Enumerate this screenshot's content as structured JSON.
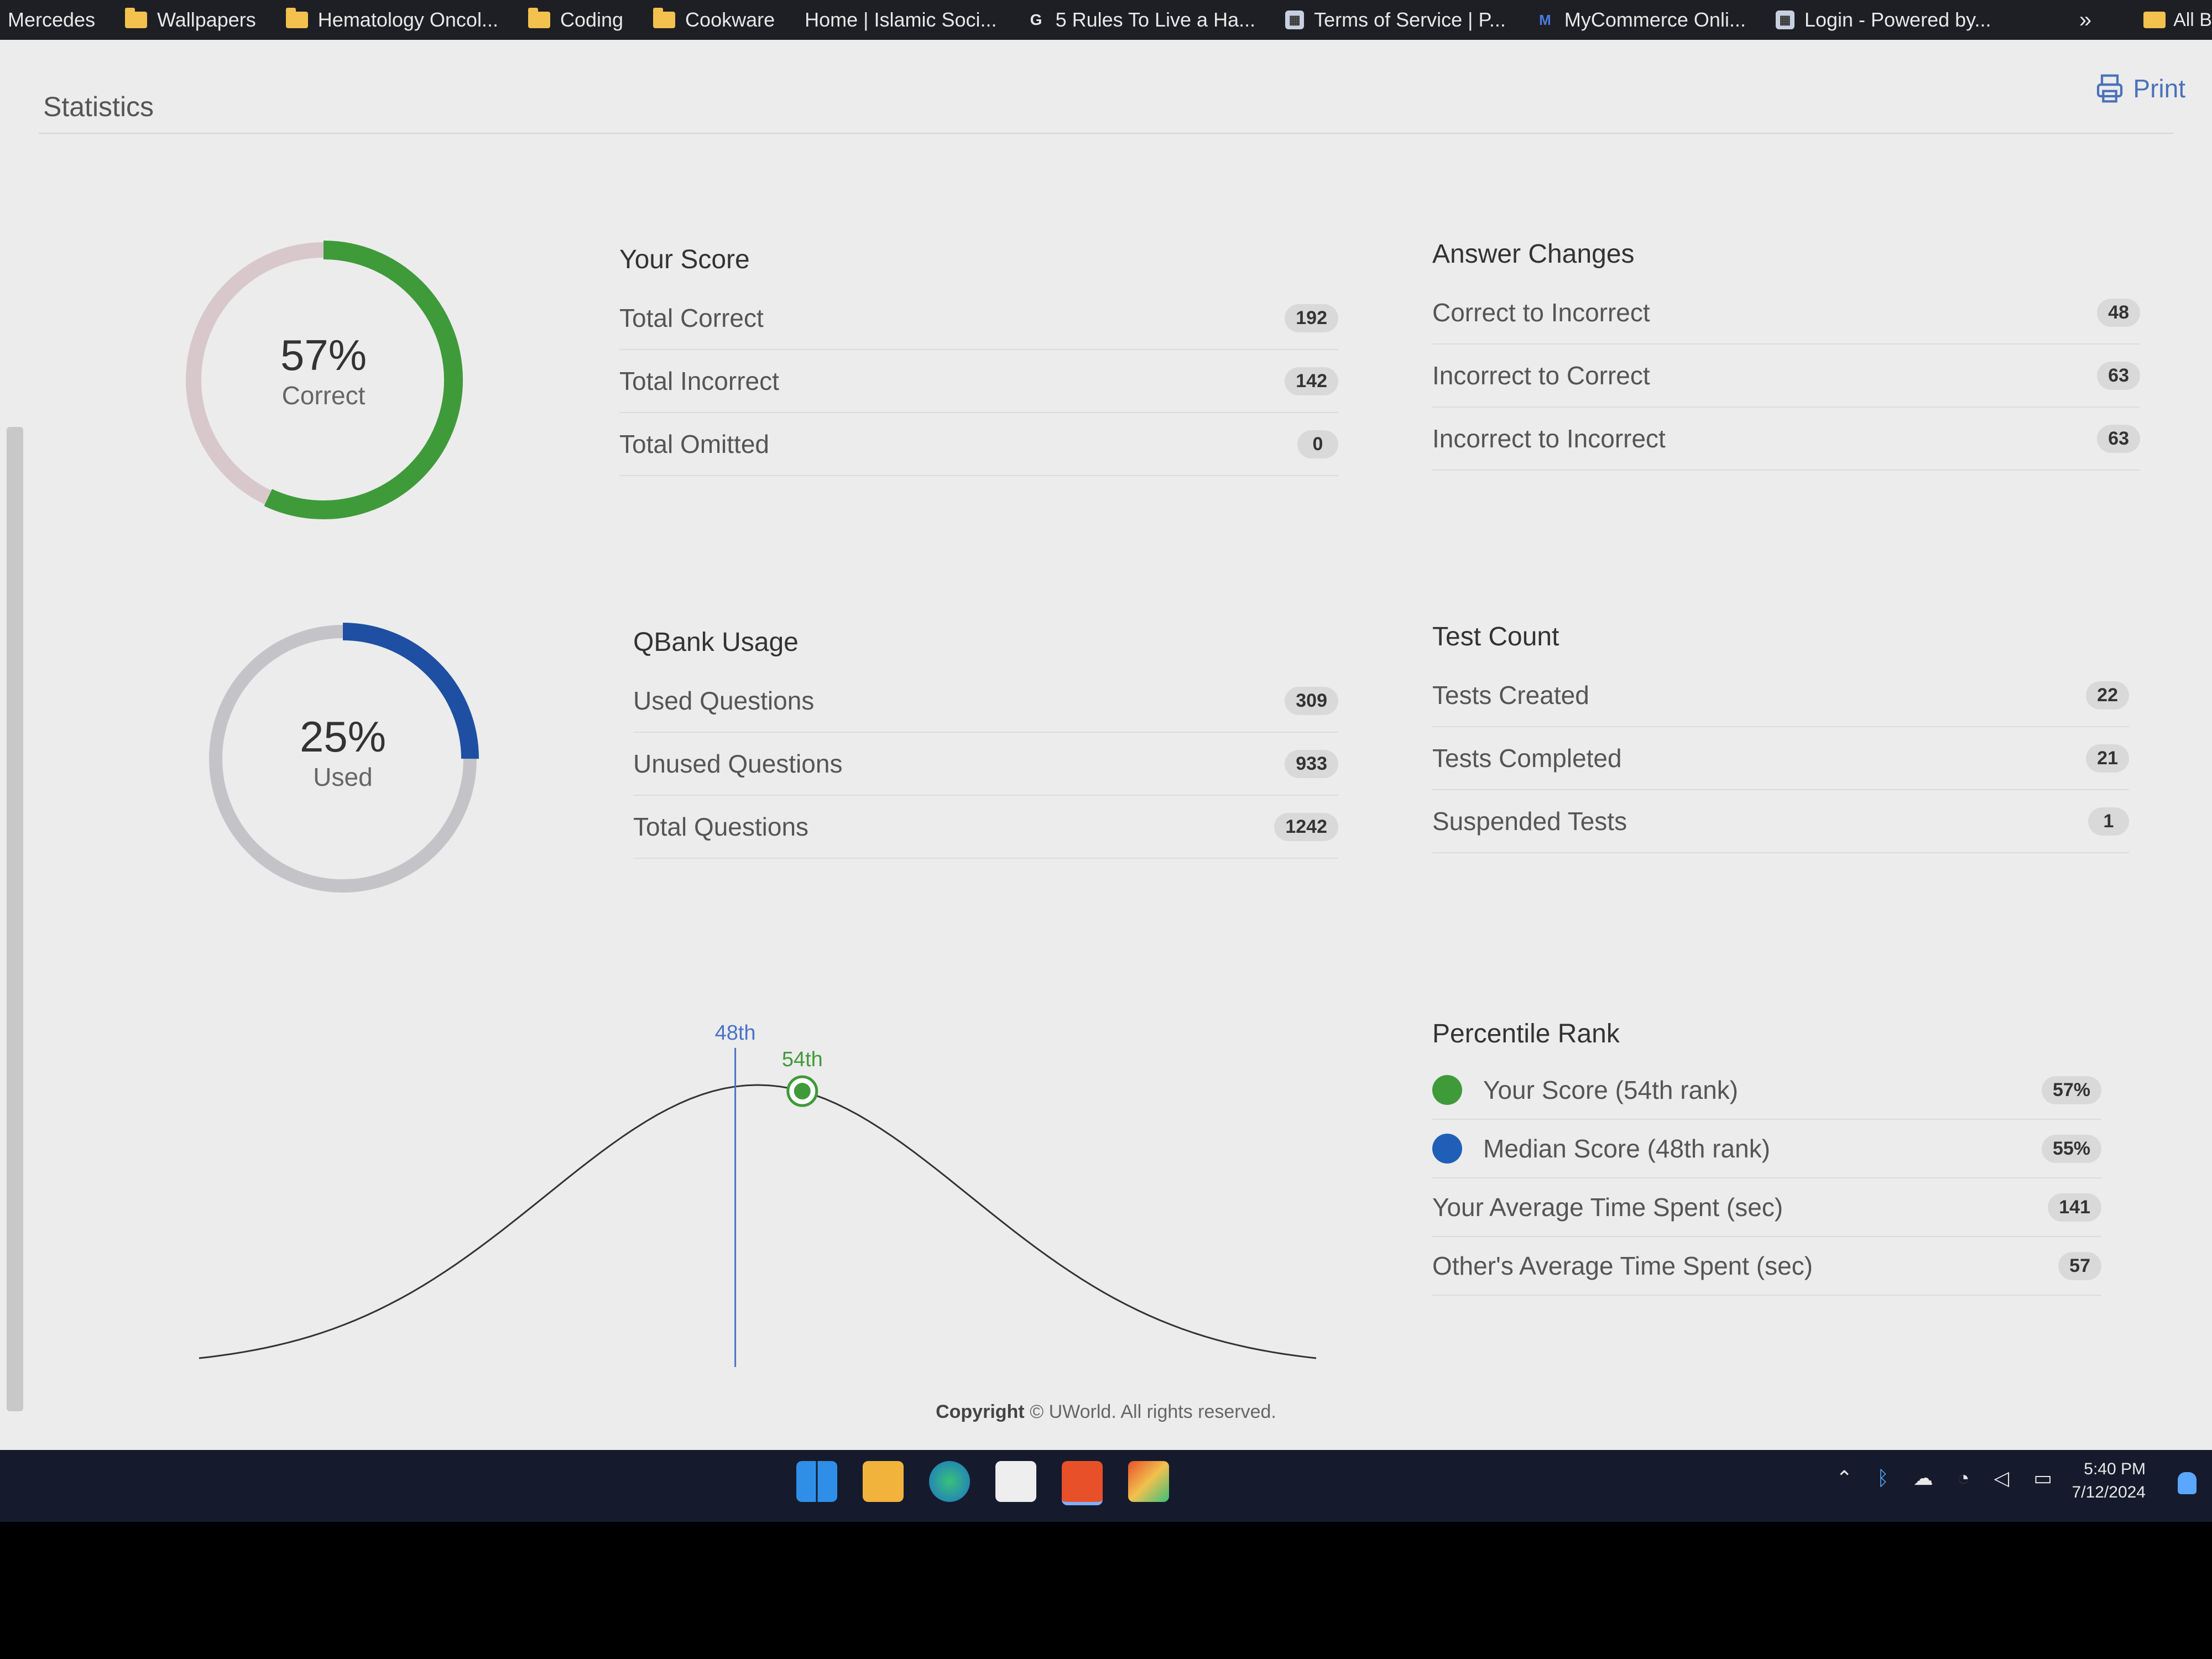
{
  "bookmarks": [
    {
      "label": "Mercedes",
      "icon": "none"
    },
    {
      "label": "Wallpapers",
      "icon": "folder-icon"
    },
    {
      "label": "Hematology Oncol...",
      "icon": "folder-icon"
    },
    {
      "label": "Coding",
      "icon": "folder-icon"
    },
    {
      "label": "Cookware",
      "icon": "folder-icon"
    },
    {
      "label": "Home | Islamic Soci...",
      "icon": "none"
    },
    {
      "label": "5 Rules To Live a Ha...",
      "icon": "google-icon"
    },
    {
      "label": "Terms of Service | P...",
      "icon": "site-icon"
    },
    {
      "label": "MyCommerce Onli...",
      "icon": "mycommerce-icon"
    },
    {
      "label": "Login - Powered by...",
      "icon": "site-icon"
    }
  ],
  "bookmarks_more": "»",
  "bookmarks_all": "All B",
  "page": {
    "title": "Statistics",
    "print_label": "Print"
  },
  "score_donut": {
    "pct_text": "57%",
    "label": "Correct",
    "value": 0.57,
    "color": "#3f9a3a",
    "track": "#d8c8cc"
  },
  "usage_donut": {
    "pct_text": "25%",
    "label": "Used",
    "value": 0.25,
    "color": "#1f4fa3",
    "track": "#c4c4c8"
  },
  "your_score": {
    "title": "Your Score",
    "rows": [
      {
        "label": "Total Correct",
        "value": "192"
      },
      {
        "label": "Total Incorrect",
        "value": "142"
      },
      {
        "label": "Total Omitted",
        "value": "0"
      }
    ]
  },
  "answer_changes": {
    "title": "Answer Changes",
    "rows": [
      {
        "label": "Correct to Incorrect",
        "value": "48"
      },
      {
        "label": "Incorrect to Correct",
        "value": "63"
      },
      {
        "label": "Incorrect to Incorrect",
        "value": "63"
      }
    ]
  },
  "qbank_usage": {
    "title": "QBank Usage",
    "rows": [
      {
        "label": "Used Questions",
        "value": "309"
      },
      {
        "label": "Unused Questions",
        "value": "933"
      },
      {
        "label": "Total Questions",
        "value": "1242"
      }
    ]
  },
  "test_count": {
    "title": "Test Count",
    "rows": [
      {
        "label": "Tests Created",
        "value": "22"
      },
      {
        "label": "Tests Completed",
        "value": "21"
      },
      {
        "label": "Suspended Tests",
        "value": "1"
      }
    ]
  },
  "percentile_rank": {
    "title": "Percentile Rank",
    "rows": [
      {
        "label": "Your Score (54th rank)",
        "value": "57%",
        "dot": "#3f9a3a"
      },
      {
        "label": "Median Score (48th rank)",
        "value": "55%",
        "dot": "#1f5fb8"
      },
      {
        "label": "Your Average Time Spent (sec)",
        "value": "141",
        "dot": null
      },
      {
        "label": "Other's Average Time Spent (sec)",
        "value": "57",
        "dot": null
      }
    ]
  },
  "chart_data": {
    "type": "line",
    "title": "",
    "xlabel": "",
    "ylabel": "",
    "markers": [
      {
        "label": "48th",
        "percentile": 48,
        "color": "#4a72c8",
        "style": "vertical-line"
      },
      {
        "label": "54th",
        "percentile": 54,
        "color": "#3f9a3a",
        "style": "point"
      }
    ],
    "grid": false
  },
  "footer": {
    "copyright_bold": "Copyright",
    "copyright_rest": "© UWorld. All rights reserved."
  },
  "taskbar": {
    "time": "5:40 PM",
    "date": "7/12/2024"
  }
}
